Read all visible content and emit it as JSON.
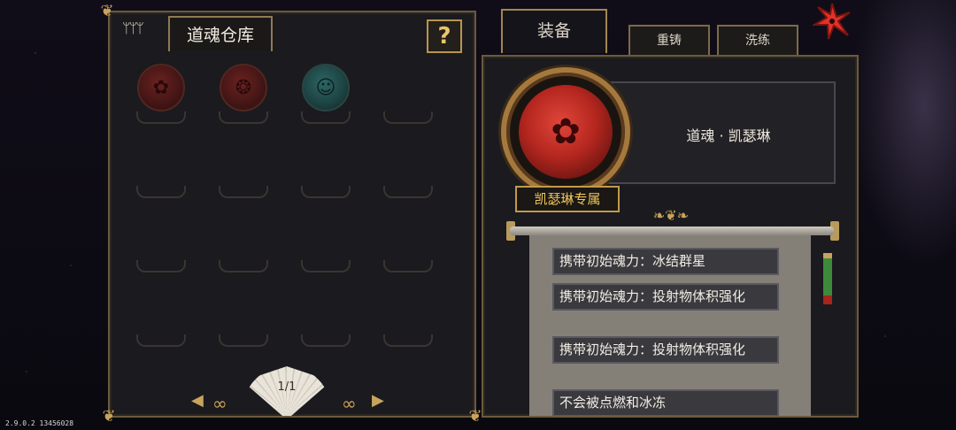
{
  "storage": {
    "title": "道魂仓库",
    "help_label": "?",
    "page_indicator": "1/1",
    "prev_label": "◀",
    "next_label": "▶",
    "slots": [
      {
        "state": "filled",
        "color": "red",
        "icon": "flower-soul-icon"
      },
      {
        "state": "filled",
        "color": "red",
        "icon": "beast-soul-icon"
      },
      {
        "state": "filled",
        "color": "teal",
        "icon": "girl-portrait-soul-icon"
      },
      {
        "state": "empty"
      },
      {
        "state": "empty"
      },
      {
        "state": "empty"
      },
      {
        "state": "empty"
      },
      {
        "state": "empty"
      },
      {
        "state": "empty"
      },
      {
        "state": "empty"
      },
      {
        "state": "empty"
      },
      {
        "state": "empty"
      },
      {
        "state": "empty"
      },
      {
        "state": "empty"
      },
      {
        "state": "empty"
      },
      {
        "state": "empty"
      }
    ]
  },
  "tabs": {
    "equip": "装备",
    "reforge": "重铸",
    "refine": "洗练"
  },
  "detail": {
    "soul_name": "道魂 · 凯瑟琳",
    "exclusive_label": "凯瑟琳专属",
    "effects": [
      "携带初始魂力：冰结群星",
      "携带初始魂力：投射物体积强化",
      "携带初始魂力：投射物体积强化",
      "不会被点燃和冰冻"
    ]
  },
  "version": "2.9.0.2 13456028",
  "colors": {
    "gold": "#c9a35a",
    "panel_bg": "#1b1a1e",
    "orb_red": "#b5271f",
    "orb_teal": "#2f6f6d",
    "close_red": "#e0322a"
  }
}
